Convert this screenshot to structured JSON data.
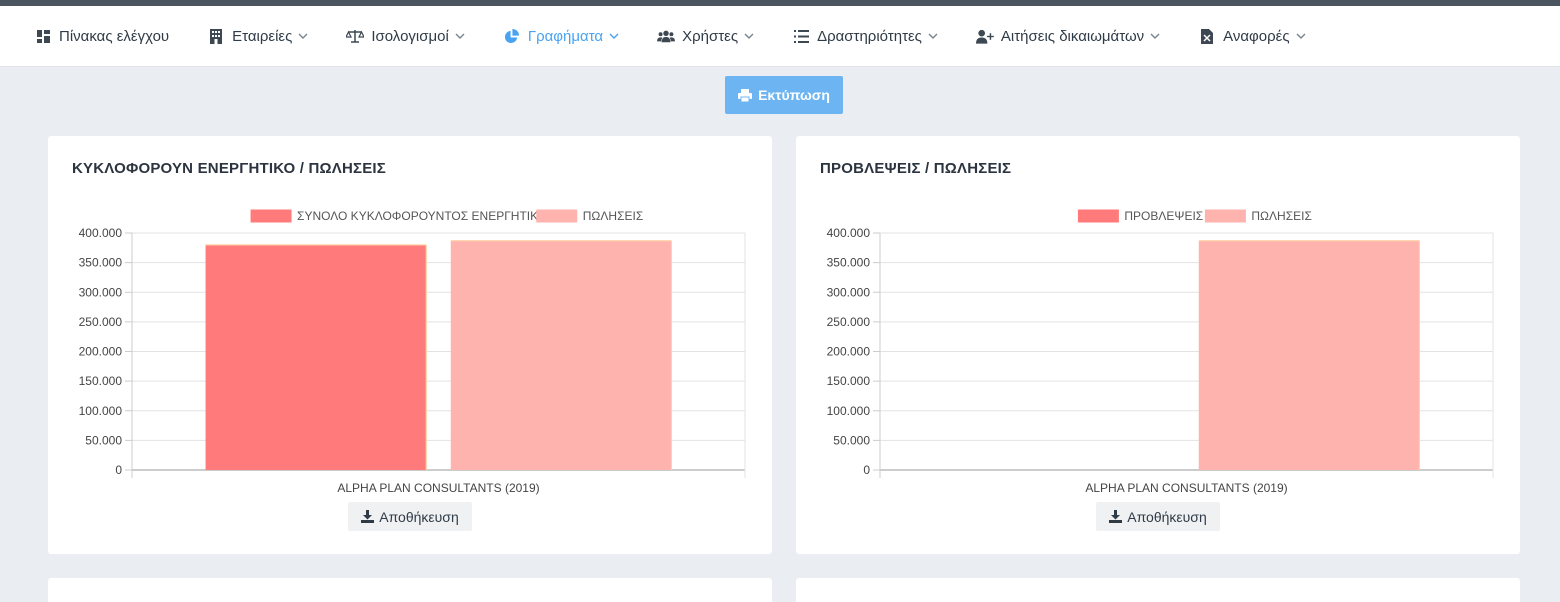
{
  "nav": {
    "items": [
      {
        "label": "Πίνακας ελέγχου",
        "icon": "dashboard-icon",
        "dropdown": false
      },
      {
        "label": "Εταιρείες",
        "icon": "building-icon",
        "dropdown": true
      },
      {
        "label": "Ισολογισμοί",
        "icon": "scale-icon",
        "dropdown": true
      },
      {
        "label": "Γραφήματα",
        "icon": "pie-chart-icon",
        "dropdown": true,
        "active": true
      },
      {
        "label": "Χρήστες",
        "icon": "users-icon",
        "dropdown": true
      },
      {
        "label": "Δραστηριότητες",
        "icon": "list-icon",
        "dropdown": true
      },
      {
        "label": "Αιτήσεις δικαιωμάτων",
        "icon": "user-plus-icon",
        "dropdown": true
      },
      {
        "label": "Αναφορές",
        "icon": "excel-file-icon",
        "dropdown": true
      }
    ],
    "active_color": "#4aa3f0"
  },
  "toolbar": {
    "print_label": "Εκτύπωση",
    "print_color": "#6cb4f2"
  },
  "cards": [
    {
      "title": "ΚΥΚΛΟΦΟΡΟΥΝ ΕΝΕΡΓΗΤΙΚΟ / ΠΩΛΗΣΕΙΣ",
      "save_label": "Αποθήκευση"
    },
    {
      "title": "ΠΡΟΒΛΕΨΕΙΣ / ΠΩΛΗΣΕΙΣ",
      "save_label": "Αποθήκευση"
    }
  ],
  "chart_data": [
    {
      "type": "bar",
      "title": "ΚΥΚΛΟΦΟΡΟΥΝ ΕΝΕΡΓΗΤΙΚΟ / ΠΩΛΗΣΕΙΣ",
      "categories": [
        "ALPHA PLAN CONSULTANTS (2019)"
      ],
      "series": [
        {
          "name": "ΣΥΝΟΛΟ ΚΥΚΛΟΦΟΡΟΥΝΤΟΣ ΕΝΕΡΓΗΤΙΚΟΥ",
          "values": [
            380000
          ],
          "color": "#ff7b7b"
        },
        {
          "name": "ΠΩΛΗΣΕΙΣ",
          "values": [
            387000
          ],
          "color": "#ffb3ae"
        }
      ],
      "ylim": [
        0,
        400000
      ],
      "yticks": [
        "400.000",
        "350.000",
        "300.000",
        "250.000",
        "200.000",
        "150.000",
        "100.000",
        "50.000",
        "0"
      ],
      "grid": true,
      "legend": "top"
    },
    {
      "type": "bar",
      "title": "ΠΡΟΒΛΕΨΕΙΣ / ΠΩΛΗΣΕΙΣ",
      "categories": [
        "ALPHA PLAN CONSULTANTS (2019)"
      ],
      "series": [
        {
          "name": "ΠΡΟΒΛΕΨΕΙΣ",
          "values": [
            0
          ],
          "color": "#ff7b7b"
        },
        {
          "name": "ΠΩΛΗΣΕΙΣ",
          "values": [
            387000
          ],
          "color": "#ffb3ae"
        }
      ],
      "ylim": [
        0,
        400000
      ],
      "yticks": [
        "400.000",
        "350.000",
        "300.000",
        "250.000",
        "200.000",
        "150.000",
        "100.000",
        "50.000",
        "0"
      ],
      "grid": true,
      "legend": "top"
    }
  ]
}
